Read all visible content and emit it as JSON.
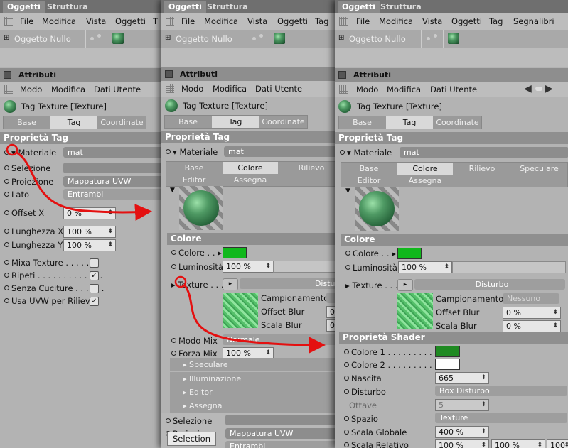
{
  "p1": {
    "tabs": [
      "Oggetti",
      "Struttura"
    ],
    "menu": [
      "File",
      "Modifica",
      "Vista",
      "Oggetti",
      "T"
    ],
    "object_name": "Oggetto Nullo",
    "attr_title": "Attributi",
    "attr_menu": [
      "Modo",
      "Modifica",
      "Dati Utente"
    ],
    "tag_title": "Tag Texture [Texture]",
    "tag_tabs": [
      "Base",
      "Tag",
      "Coordinate"
    ],
    "section": "Proprietà Tag",
    "rows": {
      "materiale": {
        "label": "Materiale",
        "value": "mat"
      },
      "selezione": {
        "label": "Selezione",
        "value": ""
      },
      "proiezione": {
        "label": "Proiezione",
        "value": "Mappatura UVW"
      },
      "lato": {
        "label": "Lato",
        "value": "Entrambi"
      },
      "offset_x": {
        "label": "Offset X",
        "value": "0 %"
      },
      "lunghezza_x": {
        "label": "Lunghezza X",
        "value": "100 %"
      },
      "lunghezza_y": {
        "label": "Lunghezza Y",
        "value": "100 %"
      }
    },
    "checks": [
      {
        "label": "Mixa Texture . . . . . . .",
        "checked": false
      },
      {
        "label": "Ripeti . . . . . . . . . . . . .",
        "checked": true
      },
      {
        "label": "Senza Cuciture . . . . . .",
        "checked": false
      },
      {
        "label": "Usa UVW per Rilievo",
        "checked": true
      }
    ]
  },
  "p2": {
    "tabs": [
      "Oggetti",
      "Struttura"
    ],
    "menu": [
      "File",
      "Modifica",
      "Vista",
      "Oggetti",
      "Tag"
    ],
    "object_name": "Oggetto Nullo",
    "attr_title": "Attributi",
    "attr_menu": [
      "Modo",
      "Modifica",
      "Dati Utente"
    ],
    "tag_title": "Tag Texture [Texture]",
    "tag_tabs": [
      "Base",
      "Tag",
      "Coordinate"
    ],
    "section": "Proprietà Tag",
    "materiale": {
      "label": "Materiale",
      "value": "mat"
    },
    "mat_tabs_row1": [
      "Base",
      "Colore",
      "Rilievo"
    ],
    "mat_tabs_row2": [
      "Editor",
      "Assegna"
    ],
    "colore_section": "Colore",
    "colore": {
      "label": "Colore"
    },
    "luminosita": {
      "label": "Luminosità",
      "value": "100 %"
    },
    "texture": {
      "label": "Texture",
      "value": "Disturb"
    },
    "campionamento": {
      "label": "Campionamento"
    },
    "offset_blur": {
      "label": "Offset Blur",
      "value": "0"
    },
    "scala_blur": {
      "label": "Scala Blur",
      "value": "0"
    },
    "modo_mix": {
      "label": "Modo Mix",
      "value": "Normale"
    },
    "forza_mix": {
      "label": "Forza Mix",
      "value": "100 %"
    },
    "subsections": [
      "Speculare",
      "Illuminazione",
      "Editor",
      "Assegna"
    ],
    "selezione": {
      "label": "Selezione"
    },
    "proiezione": {
      "label": "Proiezione",
      "value": "Mappatura UVW"
    },
    "lato_value": "Entrambi",
    "tooltip": "Selection"
  },
  "p3": {
    "tabs": [
      "Oggetti",
      "Struttura"
    ],
    "menu": [
      "File",
      "Modifica",
      "Vista",
      "Oggetti",
      "Tag",
      "Segnalibri"
    ],
    "object_name": "Oggetto Nullo",
    "attr_title": "Attributi",
    "attr_menu": [
      "Modo",
      "Modifica",
      "Dati Utente"
    ],
    "tag_title": "Tag Texture [Texture]",
    "tag_tabs": [
      "Base",
      "Tag",
      "Coordinate"
    ],
    "section": "Proprietà Tag",
    "materiale": {
      "label": "Materiale",
      "value": "mat"
    },
    "mat_tabs_row1": [
      "Base",
      "Colore",
      "Rilievo",
      "Speculare"
    ],
    "mat_tabs_row2": [
      "Editor",
      "Assegna"
    ],
    "colore_section": "Colore",
    "colore": {
      "label": "Colore"
    },
    "luminosita": {
      "label": "Luminosità",
      "value": "100 %"
    },
    "texture": {
      "label": "Texture",
      "value": "Disturbo"
    },
    "campionamento": {
      "label": "Campionamento",
      "value": "Nessuno"
    },
    "offset_blur": {
      "label": "Offset Blur",
      "value": "0 %"
    },
    "scala_blur": {
      "label": "Scala Blur",
      "value": "0 %"
    },
    "shader_section": "Proprietà Shader",
    "colore1": {
      "label": "Colore 1 . . . . . . . . . . ."
    },
    "colore2": {
      "label": "Colore 2 . . . . . . . . . . ."
    },
    "nascita": {
      "label": "Nascita",
      "value": "665"
    },
    "disturbo": {
      "label": "Disturbo",
      "value": "Box Disturbo"
    },
    "ottave": {
      "label": "Ottave",
      "value": "5"
    },
    "spazio": {
      "label": "Spazio",
      "value": "Texture"
    },
    "scala_globale": {
      "label": "Scala Globale",
      "value": "400 %"
    },
    "scala_relativo": {
      "label": "Scala Relativo",
      "values": [
        "100 %",
        "100 %",
        "100"
      ]
    }
  },
  "colors": {
    "green_swatch": "#11b81c",
    "dark_green_swatch": "#1f8a22",
    "white_swatch": "#ffffff",
    "arrow_red": "#e41010"
  }
}
